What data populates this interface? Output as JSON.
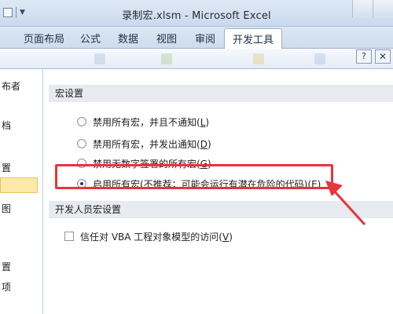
{
  "window": {
    "title": "录制宏.xlsm - Microsoft Excel"
  },
  "ribbon": {
    "tabs": [
      {
        "label": "页面布局"
      },
      {
        "label": "公式"
      },
      {
        "label": "数据"
      },
      {
        "label": "视图"
      },
      {
        "label": "审阅"
      }
    ],
    "active_tab": "开发工具",
    "help_label": "?",
    "close_label": "✕"
  },
  "sidebar": {
    "items": [
      {
        "label": "布者"
      },
      {
        "label": "档"
      },
      {
        "label": "置"
      },
      {
        "label": ""
      },
      {
        "label": "图"
      },
      {
        "label": "置"
      },
      {
        "label": "项"
      }
    ]
  },
  "macro_settings": {
    "header": "宏设置",
    "options": [
      {
        "text": "禁用所有宏，并且不通知(",
        "key": "L",
        "suffix": ")",
        "selected": false
      },
      {
        "text": "禁用所有宏，并发出通知(",
        "key": "D",
        "suffix": ")",
        "selected": false
      },
      {
        "text": "禁用无数字签署的所有宏(",
        "key": "G",
        "suffix": ")",
        "selected": false
      },
      {
        "text": "启用所有宏(不推荐；可能会运行有潜在危险的代码)(",
        "key": "E",
        "suffix": ")",
        "selected": true
      }
    ]
  },
  "developer_settings": {
    "header": "开发人员宏设置",
    "vba_text": "信任对 VBA 工程对象模型的访问(",
    "vba_key": "V",
    "vba_suffix": ")",
    "vba_checked": false
  },
  "colors": {
    "highlight": "#e8343a",
    "selected_item": "#fde9a7"
  }
}
